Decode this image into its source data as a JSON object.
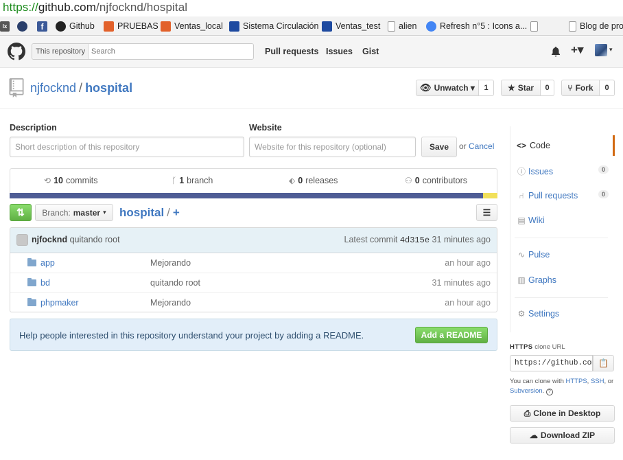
{
  "browser": {
    "url_scheme": "https://",
    "url_host": "github.com",
    "url_path": "/njfocknd/hospital",
    "bookmarks": [
      {
        "label": "",
        "icon": "ix-icon",
        "color": "#555555"
      },
      {
        "label": "",
        "icon": "globe-icon",
        "color": "#2a3f6b"
      },
      {
        "label": "",
        "icon": "facebook-icon",
        "color": "#3b5998"
      },
      {
        "label": "Github",
        "icon": "github-icon",
        "color": "#222222"
      },
      {
        "label": "PRUEBAS",
        "icon": "xampp-icon",
        "color": "#e2612b"
      },
      {
        "label": "Ventas_local",
        "icon": "xampp-icon",
        "color": "#e2612b"
      },
      {
        "label": "Sistema Circulación",
        "icon": "app-icon",
        "color": "#1e4aa0"
      },
      {
        "label": "Ventas_test",
        "icon": "app-icon",
        "color": "#1e4aa0"
      },
      {
        "label": "alien",
        "icon": "page-icon",
        "color": "#ffffff"
      },
      {
        "label": "Refresh n°5 : Icons a...",
        "icon": "chrome-icon",
        "color": "#4285f4"
      },
      {
        "label": "",
        "icon": "page-icon",
        "color": "#ffffff"
      },
      {
        "label": "Blog de pro",
        "icon": "page-icon",
        "color": "#ffffff"
      }
    ]
  },
  "header": {
    "search_scope": "This repository",
    "search_placeholder": "Search",
    "nav": [
      "Pull requests",
      "Issues",
      "Gist"
    ],
    "plus": "+▾"
  },
  "repo": {
    "owner": "njfocknd",
    "separator": "/",
    "name": "hospital",
    "unwatch_label": "Unwatch ▾",
    "watch_count": "1",
    "star_label": "Star",
    "star_count": "0",
    "fork_label": "Fork",
    "fork_count": "0"
  },
  "edit": {
    "description_label": "Description",
    "description_placeholder": "Short description of this repository",
    "website_label": "Website",
    "website_placeholder": "Website for this repository (optional)",
    "save_label": "Save",
    "or_text": "or",
    "cancel_label": "Cancel"
  },
  "summary": {
    "commits_count": "10",
    "commits_label": "commits",
    "branch_count": "1",
    "branch_label": "branch",
    "releases_count": "0",
    "releases_label": "releases",
    "contributors_count": "0",
    "contributors_label": "contributors",
    "language_colors": [
      "#4f5d95",
      "#f1e05a"
    ],
    "language_shares": [
      0.97,
      0.03
    ]
  },
  "filenav": {
    "branch_prefix": "Branch:",
    "branch_name": "master",
    "root": "hospital",
    "slash": "/",
    "plus": "+"
  },
  "commit": {
    "author": "njfocknd",
    "message": "quitando root",
    "latest_label": "Latest commit",
    "sha": "4d315e",
    "age": "31 minutes ago"
  },
  "files": [
    {
      "name": "app",
      "message": "Mejorando",
      "age": "an hour ago"
    },
    {
      "name": "bd",
      "message": "quitando root",
      "age": "31 minutes ago"
    },
    {
      "name": "phpmaker",
      "message": "Mejorando",
      "age": "an hour ago"
    }
  ],
  "readme": {
    "text": "Help people interested in this repository understand your project by adding a README.",
    "button": "Add a README"
  },
  "sidebar": {
    "code": "Code",
    "issues": "Issues",
    "issues_count": "0",
    "pulls": "Pull requests",
    "pulls_count": "0",
    "wiki": "Wiki",
    "pulse": "Pulse",
    "graphs": "Graphs",
    "settings": "Settings",
    "clone_title": "HTTPS",
    "clone_suffix": "clone URL",
    "clone_url": "https://github.com/njfocknd/hospital.git",
    "clone_help_1": "You can clone with",
    "clone_https": "HTTPS",
    "clone_ssh": "SSH",
    "clone_help_2": ", or",
    "clone_subversion": "Subversion",
    "clone_help_3": ".",
    "desktop_label": "Clone in Desktop",
    "zip_label": "Download ZIP"
  },
  "colors": {
    "link": "#4078c0",
    "green": "#60b044",
    "active_tab": "#d26911"
  }
}
